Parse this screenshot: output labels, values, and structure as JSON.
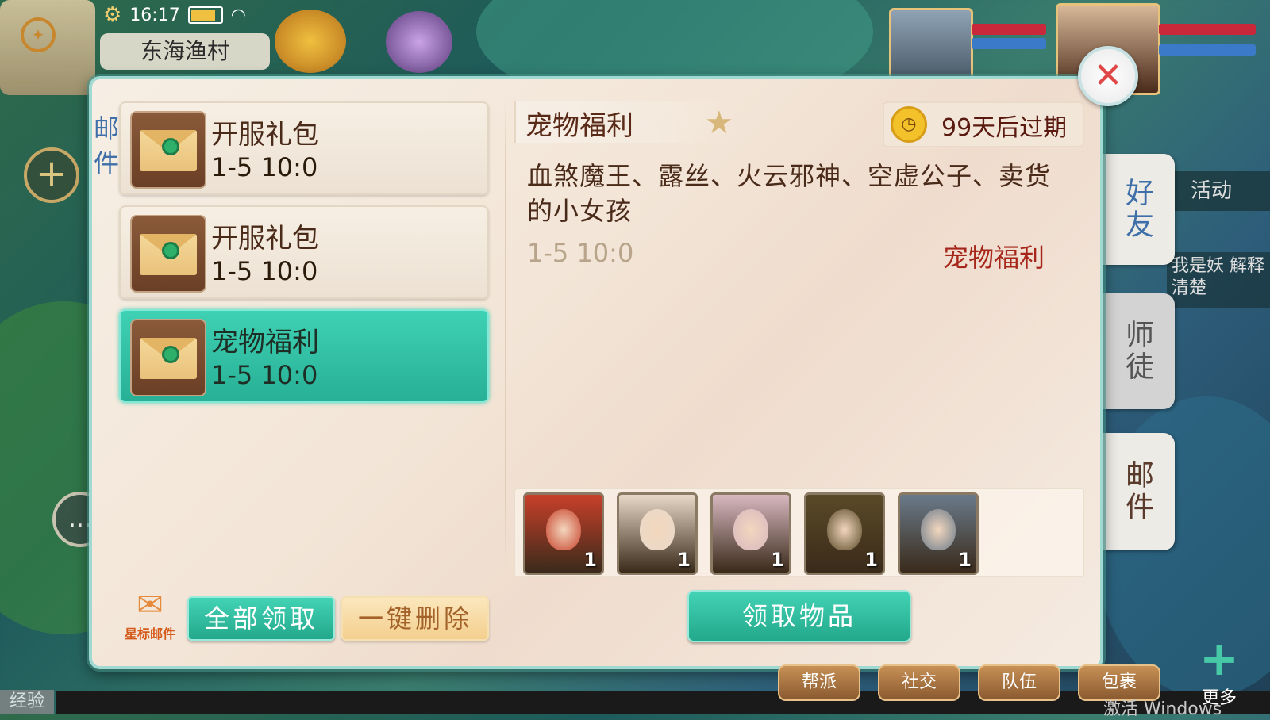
{
  "hud": {
    "time": "16:17",
    "location": "东海渔村"
  },
  "panel": {
    "tag": "邮件",
    "mails": [
      {
        "title": "开服礼包",
        "date": "1-5 10:0"
      },
      {
        "title": "开服礼包",
        "date": "1-5 10:0"
      },
      {
        "title": "宠物福利",
        "date": "1-5 10:0"
      }
    ],
    "star_mail_label": "星标邮件",
    "claim_all_label": "全部领取",
    "delete_all_label": "一键删除"
  },
  "detail": {
    "title": "宠物福利",
    "expiry": "99天后过期",
    "body": "血煞魔王、露丝、火云邪神、空虚公子、卖货的小女孩",
    "date": "1-5 10:0",
    "sender": "宠物福利",
    "rewards": [
      {
        "count": "1",
        "color": "#c8402a"
      },
      {
        "count": "1",
        "color": "#e8d8c8"
      },
      {
        "count": "1",
        "color": "#d8b8c0"
      },
      {
        "count": "1",
        "color": "#5a4a28"
      },
      {
        "count": "1",
        "color": "#6a7a8a"
      }
    ],
    "claim_label": "领取物品"
  },
  "side_tabs": {
    "friends": "好友",
    "mentor": "师徒",
    "mail": "邮件"
  },
  "side_info": {
    "activity": "活动",
    "chat_preview": "我是妖 解释清楚"
  },
  "bottom": {
    "buttons": [
      "帮派",
      "社交",
      "队伍",
      "包裹"
    ],
    "more": "更多",
    "exp": "经验",
    "watermark": "激活 Windows"
  },
  "colors": {
    "accent_teal": "#27b095",
    "panel_bg": "#f3e6d8",
    "title_red": "#a6261a"
  }
}
